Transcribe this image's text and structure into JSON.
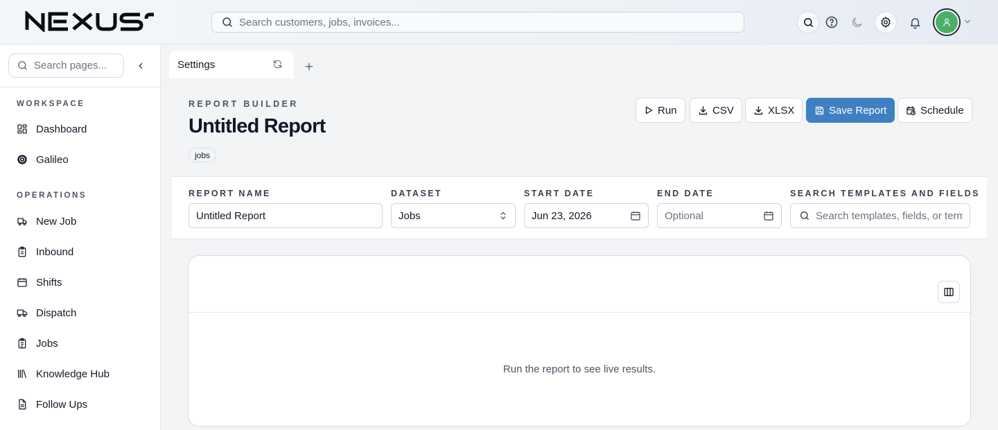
{
  "app": {
    "brand": "NEXUS",
    "search_placeholder": "Search customers, jobs, invoices..."
  },
  "topbar": {
    "icons": [
      "search-icon",
      "help-icon",
      "moon-icon",
      "gear-icon",
      "bell-icon",
      "user-icon",
      "chevron-down-icon"
    ]
  },
  "sidebar": {
    "search_placeholder": "Search pages...",
    "sections": [
      {
        "label": "WORKSPACE",
        "items": [
          {
            "label": "Dashboard",
            "icon": "dashboard-icon"
          },
          {
            "label": "Galileo",
            "icon": "galileo-icon"
          }
        ]
      },
      {
        "label": "OPERATIONS",
        "items": [
          {
            "label": "New Job",
            "icon": "truck-icon"
          },
          {
            "label": "Inbound",
            "icon": "clipboard-icon"
          },
          {
            "label": "Shifts",
            "icon": "calendar-icon"
          },
          {
            "label": "Dispatch",
            "icon": "dispatch-truck-icon"
          },
          {
            "label": "Jobs",
            "icon": "clipboard-list-icon"
          },
          {
            "label": "Knowledge Hub",
            "icon": "library-icon"
          },
          {
            "label": "Follow Ups",
            "icon": "file-icon"
          }
        ]
      }
    ]
  },
  "tabs": [
    {
      "label": "Settings",
      "active": true
    }
  ],
  "header": {
    "eyebrow": "REPORT BUILDER",
    "title": "Untitled Report",
    "chip": "jobs"
  },
  "actions": {
    "run": "Run",
    "csv": "CSV",
    "xlsx": "XLSX",
    "save": "Save Report",
    "schedule": "Schedule"
  },
  "filters": {
    "report_name": {
      "label": "REPORT NAME",
      "value": "Untitled Report"
    },
    "dataset": {
      "label": "DATASET",
      "value": "Jobs"
    },
    "start_date": {
      "label": "START DATE",
      "value": "Jun 23, 2026"
    },
    "end_date": {
      "label": "END DATE",
      "placeholder": "Optional"
    },
    "search": {
      "label": "SEARCH TEMPLATES AND FIELDS",
      "placeholder": "Search templates, fields, or terms"
    }
  },
  "results": {
    "empty_message": "Run the report to see live results."
  },
  "colors": {
    "primary": "#3f80c2",
    "avatar": "#4caf66"
  }
}
